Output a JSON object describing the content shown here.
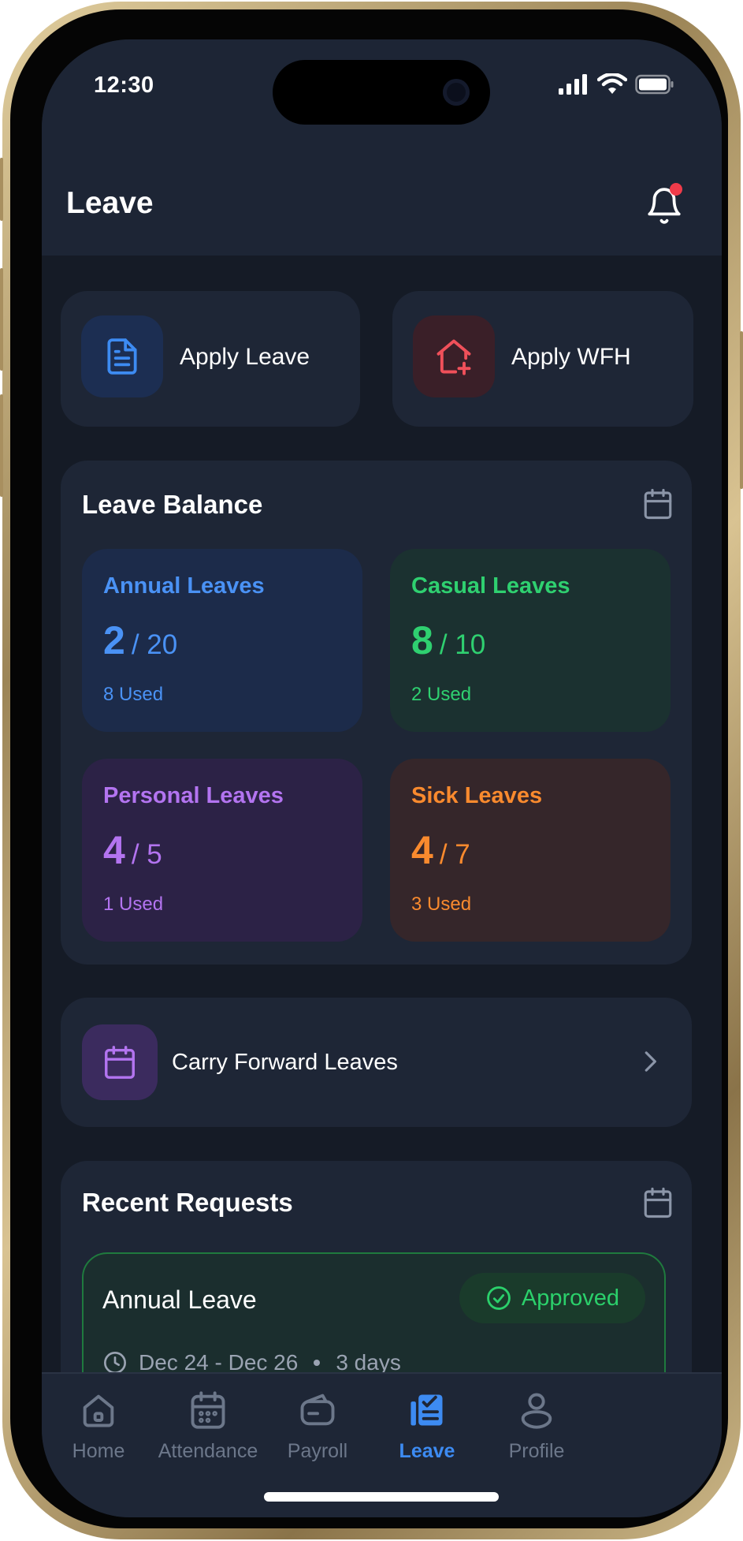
{
  "status_bar": {
    "time": "12:30"
  },
  "header": {
    "title": "Leave"
  },
  "quick_actions": [
    {
      "label": "Apply Leave",
      "icon": "document-icon",
      "color": "#3d8bf2"
    },
    {
      "label": "Apply WFH",
      "icon": "house-plus-icon",
      "color": "#f0505a"
    }
  ],
  "leave_balance": {
    "title": "Leave Balance",
    "items": [
      {
        "title": "Annual Leaves",
        "available": "2",
        "total": "/ 20",
        "used": "8 Used",
        "color": "#4a92f5",
        "bg": "#1c2b4a"
      },
      {
        "title": "Casual Leaves",
        "available": "8",
        "total": "/ 10",
        "used": "2 Used",
        "color": "#2fd070",
        "bg": "#1b3130"
      },
      {
        "title": "Personal Leaves",
        "available": "4",
        "total": "/ 5",
        "used": "1 Used",
        "color": "#b374f0",
        "bg": "#2c2246"
      },
      {
        "title": "Sick Leaves",
        "available": "4",
        "total": "/ 7",
        "used": "3 Used",
        "color": "#f98a2e",
        "bg": "#35262a"
      }
    ]
  },
  "carry_forward": {
    "label": "Carry Forward Leaves"
  },
  "recent_requests": {
    "title": "Recent Requests",
    "items": [
      {
        "type": "Annual Leave",
        "status": "Approved",
        "dates": "Dec 24 - Dec 26",
        "duration": "3 days"
      }
    ]
  },
  "tabs": [
    {
      "label": "Home",
      "icon": "home-icon",
      "active": false
    },
    {
      "label": "Attendance",
      "icon": "calendar-icon",
      "active": false
    },
    {
      "label": "Payroll",
      "icon": "wallet-icon",
      "active": false
    },
    {
      "label": "Leave",
      "icon": "leave-checklist-icon",
      "active": true
    },
    {
      "label": "Profile",
      "icon": "person-icon",
      "active": false
    }
  ],
  "colors": {
    "accent": "#3d8bf2",
    "approved": "#2bd06b",
    "notification_dot": "#ef3b4a",
    "background": "#151b26",
    "card": "#1e2636"
  }
}
